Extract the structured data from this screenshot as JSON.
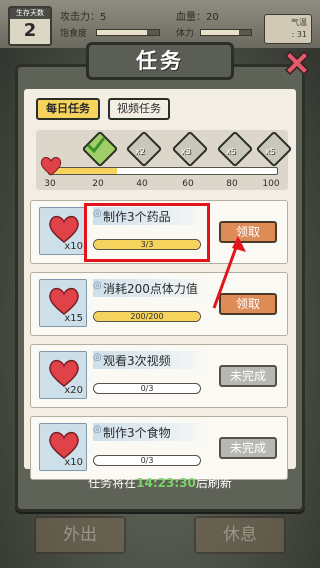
{
  "hud": {
    "day_label": "生存天数",
    "day_value": "2",
    "attack_label": "攻击力：5",
    "health_label": "血量：20",
    "satiety_label": "饱食度",
    "stamina_label": "体力",
    "temp_label": "气温",
    "temp_value": ": 31"
  },
  "panel": {
    "title": "任务",
    "tabs": [
      {
        "label": "每日任务",
        "active": true
      },
      {
        "label": "视频任务",
        "active": false
      }
    ]
  },
  "progress": {
    "current": 30,
    "max": 100,
    "ticks": [
      "30",
      "20",
      "40",
      "60",
      "80",
      "100"
    ],
    "rewards": [
      {
        "label": "",
        "done": true
      },
      {
        "label": "x2",
        "done": false
      },
      {
        "label": "x3",
        "done": false
      },
      {
        "label": "x5",
        "done": false
      },
      {
        "label": "x5",
        "done": false
      }
    ]
  },
  "tasks": [
    {
      "name": "制作3个药品",
      "reward_count": "x10",
      "progress_text": "3/3",
      "ratio": 1.0,
      "action": "领取",
      "status": "claim"
    },
    {
      "name": "消耗200点体力值",
      "reward_count": "x15",
      "progress_text": "200/200",
      "ratio": 1.0,
      "action": "领取",
      "status": "claim"
    },
    {
      "name": "观看3次视频",
      "reward_count": "x20",
      "progress_text": "0/3",
      "ratio": 0.0,
      "action": "未完成",
      "status": "pending"
    },
    {
      "name": "制作3个食物",
      "reward_count": "x10",
      "progress_text": "0/3",
      "ratio": 0.0,
      "action": "未完成",
      "status": "pending"
    }
  ],
  "refresh": {
    "prefix": "任务将在",
    "time": "14:23:30",
    "suffix": "后刷新"
  },
  "bottom": {
    "left_label": "外出",
    "right_label": "休息"
  },
  "colors": {
    "accent_yellow": "#f6d35c",
    "claim_orange": "#dd8b57",
    "highlight_red": "#e3141b",
    "timer_green": "#7dd36b"
  }
}
